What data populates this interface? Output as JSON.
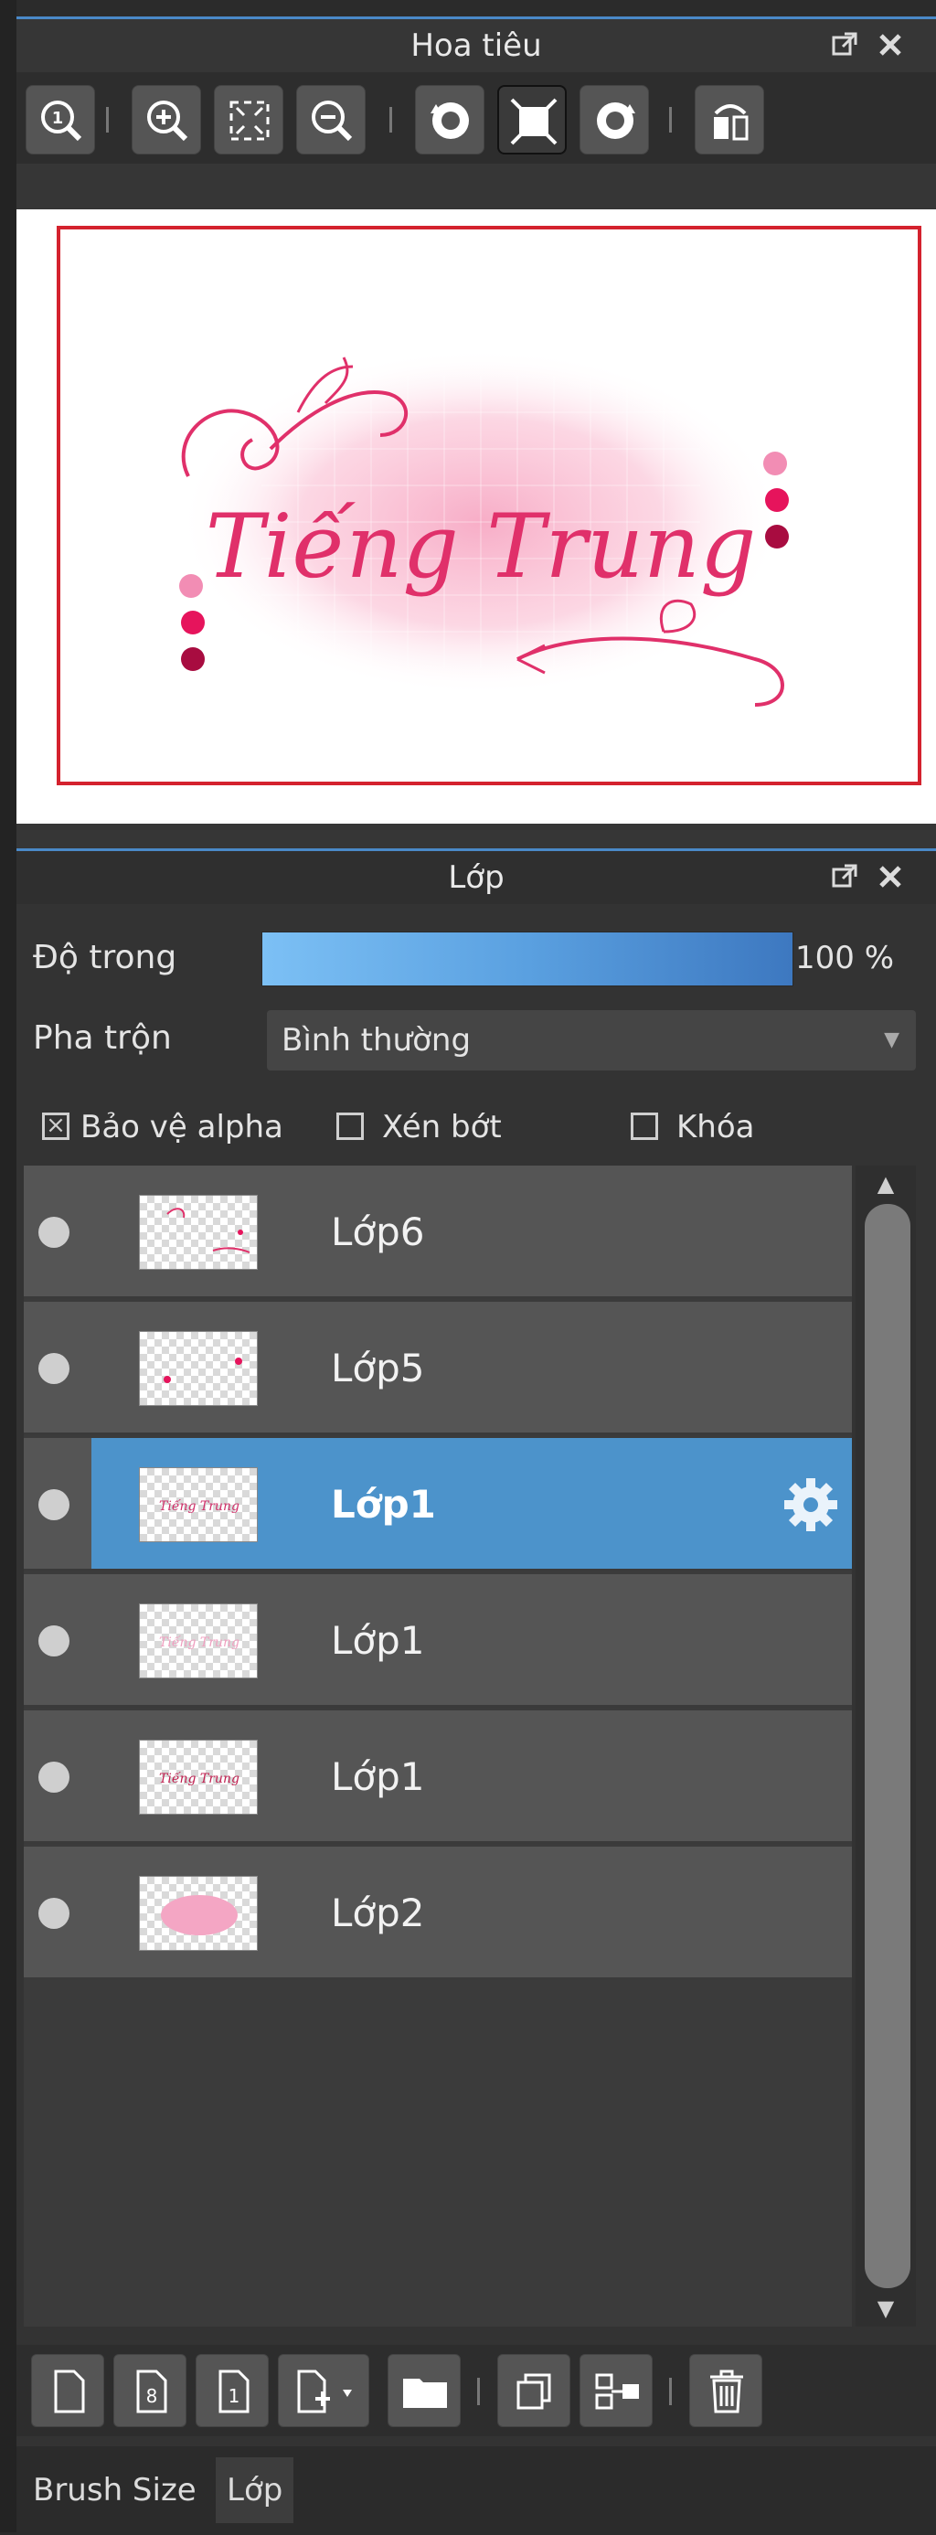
{
  "navigator": {
    "title": "Hoa tiêu",
    "popout_icon": "popout-icon",
    "close_icon": "close-icon",
    "toolbar": [
      "zoom-actual-icon",
      "zoom-in-icon",
      "fit-screen-icon",
      "zoom-out-icon",
      "rotate-left-icon",
      "reset-view-icon",
      "rotate-right-icon",
      "flip-horizontal-icon"
    ],
    "preview_text": "Tiếng Trung"
  },
  "layers_panel": {
    "title": "Lớp",
    "opacity_label": "Độ trong",
    "opacity_value": "100 %",
    "opacity_level": 1.0,
    "blend_label": "Pha trộn",
    "blend_value": "Bình thường",
    "protect_alpha_label": "Bảo vệ alpha",
    "protect_alpha_checked": true,
    "clipping_label": "Xén bớt",
    "clipping_checked": false,
    "lock_label": "Khóa",
    "lock_checked": false,
    "layers": [
      {
        "name": "Lớp6",
        "selected": false
      },
      {
        "name": "Lớp5",
        "selected": false
      },
      {
        "name": "Lớp1",
        "selected": true
      },
      {
        "name": "Lớp1",
        "selected": false
      },
      {
        "name": "Lớp1",
        "selected": false
      },
      {
        "name": "Lớp2",
        "selected": false
      }
    ],
    "bottom_toolbar": [
      "new-layer-icon",
      "new-8bit-layer-icon",
      "new-1bit-layer-icon",
      "add-special-layer-icon",
      "new-folder-icon",
      "duplicate-layer-icon",
      "merge-down-icon",
      "delete-layer-icon"
    ]
  },
  "tabs": [
    "Brush Size",
    "Lớp"
  ],
  "colors": {
    "accent": "#4a89c8",
    "selected_row": "#4c93cb",
    "frame": "#d4222e",
    "ink": "#e0306a"
  }
}
